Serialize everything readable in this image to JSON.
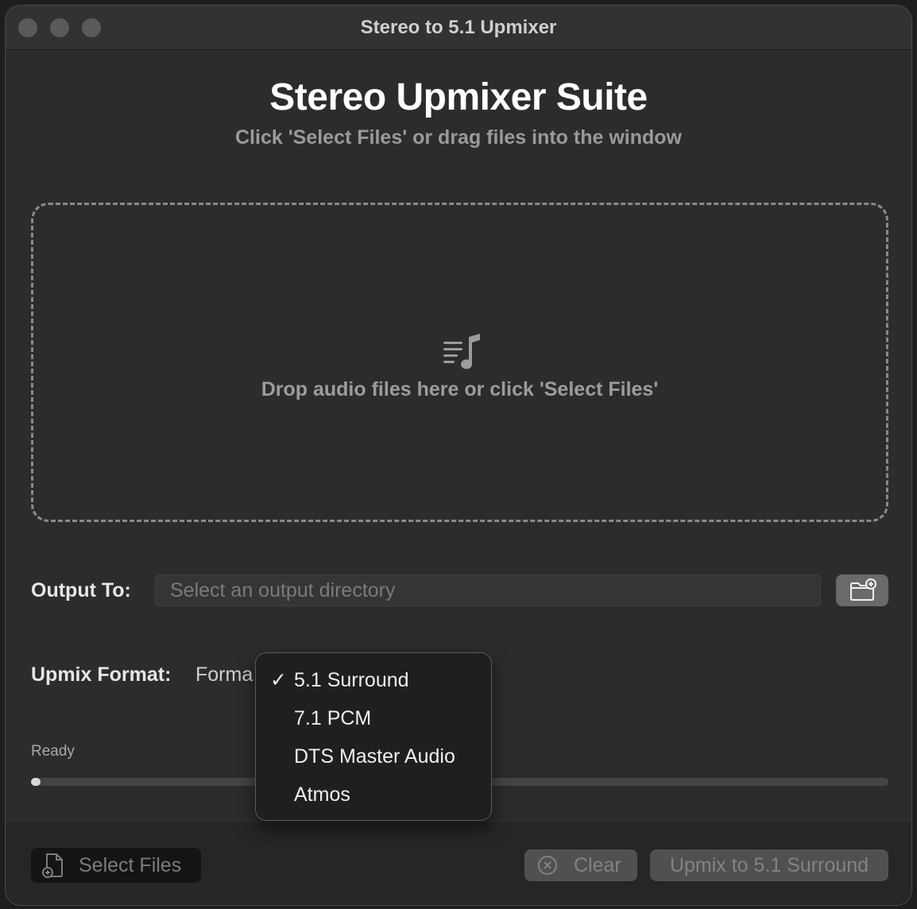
{
  "window": {
    "title": "Stereo to 5.1 Upmixer"
  },
  "header": {
    "title": "Stereo Upmixer Suite",
    "subtitle": "Click 'Select Files' or drag files into the window"
  },
  "dropzone": {
    "icon": "music-list-icon",
    "text": "Drop audio files here or click 'Select Files'"
  },
  "output": {
    "label": "Output To:",
    "placeholder": "Select an output directory",
    "folder_button_icon": "folder-add-icon"
  },
  "format": {
    "label": "Upmix Format:",
    "select_text": "Forma",
    "options": [
      "5.1 Surround",
      "7.1 PCM",
      "DTS Master Audio",
      "Atmos"
    ],
    "selected": "5.1 Surround",
    "check": "✓"
  },
  "status": {
    "text": "Ready",
    "progress": 0.0
  },
  "buttons": {
    "select_files": "Select Files",
    "clear": "Clear",
    "upmix": "Upmix to 5.1 Surround"
  },
  "colors": {
    "window_bg": "#2c2c2c",
    "popup_bg": "#1f1f1f",
    "text_primary": "#ffffff",
    "text_muted": "#9a9a9a"
  }
}
